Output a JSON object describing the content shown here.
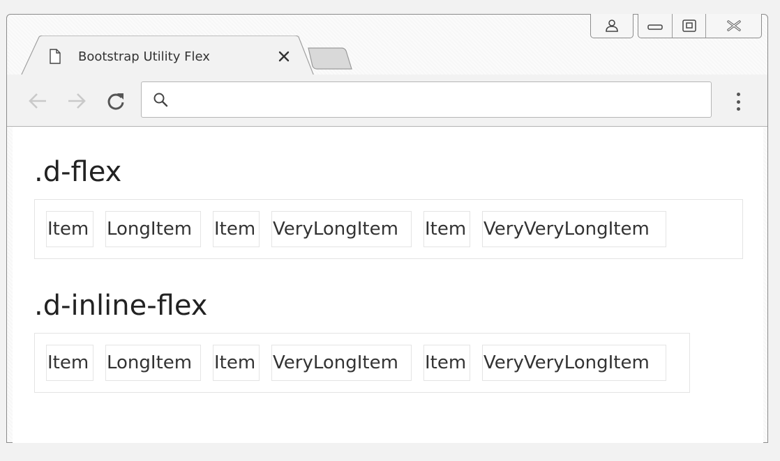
{
  "tab": {
    "title": "Bootstrap Utility Flex",
    "close_glyph": "✕"
  },
  "window_controls": [
    "user-icon",
    "minimize-icon",
    "restore-icon",
    "close-icon"
  ],
  "toolbar": {
    "back_icon": "arrow-left-icon",
    "forward_icon": "arrow-right-icon",
    "reload_icon": "reload-icon",
    "omnibox": {
      "value": "",
      "placeholder": ""
    },
    "menu_icon": "more-vert-icon"
  },
  "sections": [
    {
      "heading": ".d-flex",
      "items": [
        "Item",
        "LongItem",
        "Item",
        "VeryLongItem",
        "Item",
        "VeryVeryLongItem"
      ]
    },
    {
      "heading": ".d-inline-flex",
      "items": [
        "Item",
        "LongItem",
        "Item",
        "VeryLongItem",
        "Item",
        "VeryVeryLongItem"
      ]
    }
  ],
  "colors": {
    "chrome_bg": "#f2f2f2",
    "border": "#e3e3e3",
    "text": "#222222"
  }
}
